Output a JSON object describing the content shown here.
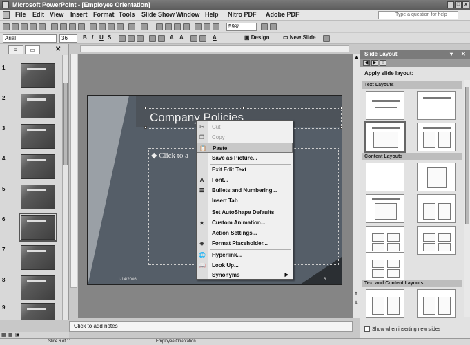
{
  "window": {
    "title": "Microsoft PowerPoint - [Employee Orientation]"
  },
  "menubar": {
    "items": [
      "File",
      "Edit",
      "View",
      "Insert",
      "Format",
      "Tools",
      "Slide Show",
      "Window",
      "Help",
      "Nitro PDF",
      "Adobe PDF"
    ],
    "help_placeholder": "Type a question for help"
  },
  "toolbar": {
    "zoom": "59%",
    "font": "Arial",
    "font_size": "36",
    "design_label": "Design",
    "new_slide_label": "New Slide"
  },
  "slides_pane": {
    "tabs": [
      "Outline",
      "Slides"
    ],
    "slide_numbers": [
      "1",
      "2",
      "3",
      "4",
      "5",
      "6",
      "7",
      "8",
      "9"
    ],
    "selected": "6"
  },
  "slide": {
    "title": "Company Policies",
    "body_placeholder": "Click to a",
    "date": "1/14/2006",
    "number": "6"
  },
  "context_menu": {
    "items": [
      {
        "label": "Cut",
        "icon": "scissors-icon",
        "disabled": true
      },
      {
        "label": "Copy",
        "icon": "copy-icon",
        "disabled": true
      },
      {
        "label": "Paste",
        "icon": "paste-icon",
        "highlighted": true
      },
      {
        "label": "Save as Picture..."
      },
      {
        "label": "Exit Edit Text"
      },
      {
        "label": "Font...",
        "icon": "font-icon"
      },
      {
        "label": "Bullets and Numbering...",
        "icon": "bullets-icon"
      },
      {
        "label": "Insert Tab"
      },
      {
        "label": "Set AutoShape Defaults"
      },
      {
        "label": "Custom Animation...",
        "icon": "animation-icon"
      },
      {
        "label": "Action Settings..."
      },
      {
        "label": "Format Placeholder...",
        "icon": "format-icon"
      },
      {
        "label": "Hyperlink...",
        "icon": "hyperlink-icon"
      },
      {
        "label": "Look Up...",
        "icon": "lookup-icon"
      },
      {
        "label": "Synonyms",
        "submenu": true
      }
    ]
  },
  "notes": {
    "placeholder": "Click to add notes"
  },
  "status": {
    "slide": "Slide 6 of 11",
    "design": "Employee Orientation"
  },
  "task_pane": {
    "title": "Slide Layout",
    "apply_label": "Apply slide layout:",
    "sections": [
      "Text Layouts",
      "Content Layouts",
      "Text and Content Layouts"
    ],
    "checkbox_label": "Show when inserting new slides"
  }
}
